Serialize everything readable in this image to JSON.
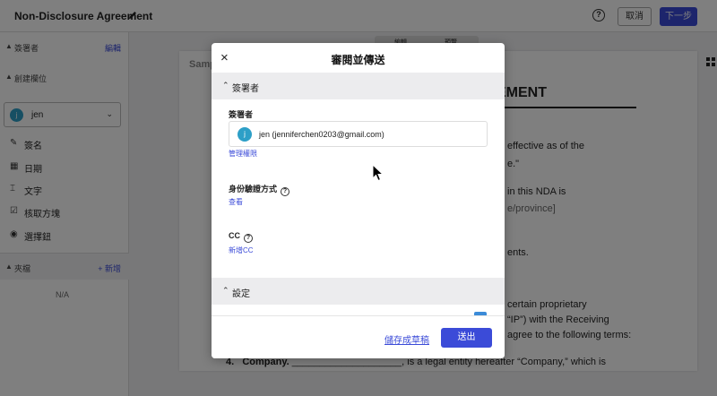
{
  "header": {
    "title": "Non-Disclosure Agreement",
    "help_label": "?",
    "cancel_label": "取消",
    "next_label": "下一步"
  },
  "sidebar": {
    "signers_label": "簽署者",
    "signers_action": "編輯",
    "fields_label": "創建欄位",
    "selected_signer": "jen",
    "avatar_initial": "j",
    "fields": [
      {
        "label": "簽名",
        "icon": "pen-icon"
      },
      {
        "label": "日期",
        "icon": "calendar-icon"
      },
      {
        "label": "文字",
        "icon": "text-icon"
      },
      {
        "label": "核取方塊",
        "icon": "checkbox-icon"
      },
      {
        "label": "選擇鈕",
        "icon": "radio-icon"
      }
    ],
    "templates_label": "夾檔",
    "templates_action": "+ 新增",
    "empty": "N/A"
  },
  "canvas": {
    "tabs": [
      "編輯",
      "預覽"
    ],
    "partial_title": "Samp",
    "heading_partial": "EMENT",
    "lines": [
      "effective as of the",
      "e.\"",
      "in this NDA is",
      "e/province]",
      "ents.",
      "certain proprietary",
      "“IP”) with the Receiving",
      "agree to the following terms:"
    ],
    "bottom_line_num": "4.",
    "bottom_line_bold": "Company.",
    "bottom_line_rest": "____________________, is a legal entity hereafter “Company,” which is"
  },
  "modal": {
    "title": "審閱並傳送",
    "close_icon": "×",
    "section_signers": "簽署者",
    "signers_field_label": "簽署者",
    "recipient_initial": "j",
    "recipient": "jen (jenniferchen0203@gmail.com)",
    "manage_perm_link": "管理權限",
    "auth_label": "身份驗證方式",
    "auth_link": "查看",
    "cc_label": "CC",
    "cc_link": "新增CC",
    "section_settings": "設定",
    "save_draft": "儲存成草稿",
    "send": "送出"
  }
}
